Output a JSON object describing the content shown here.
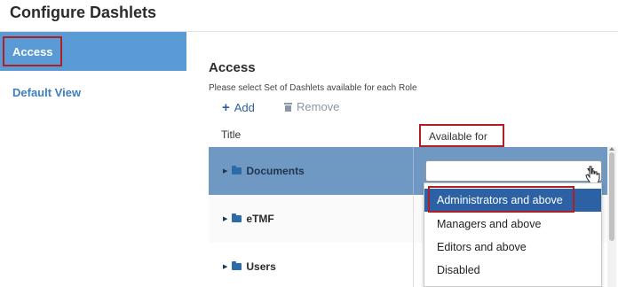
{
  "page": {
    "title": "Configure Dashlets"
  },
  "sidebar": {
    "items": [
      {
        "label": "Access",
        "active": true
      },
      {
        "label": "Default View",
        "active": false
      }
    ]
  },
  "content": {
    "title": "Access",
    "description": "Please select Set of Dashlets available for each Role",
    "toolbar": {
      "add_label": "Add",
      "remove_label": "Remove"
    },
    "columns": {
      "title": "Title",
      "available_for": "Available for"
    },
    "rows": [
      {
        "label": "Documents"
      },
      {
        "label": "eTMF"
      },
      {
        "label": "Users"
      }
    ],
    "dropdown": {
      "value": "",
      "options": [
        "Administrators and above",
        "Managers and above",
        "Editors and above",
        "Disabled"
      ],
      "highlighted_option": "Administrators and above"
    }
  },
  "colors": {
    "accent": "#5a9bd5",
    "highlight_border": "#b01f24",
    "selected_row": "#6f98c2",
    "selected_option": "#2d61a6",
    "link": "#3d7fbf"
  }
}
